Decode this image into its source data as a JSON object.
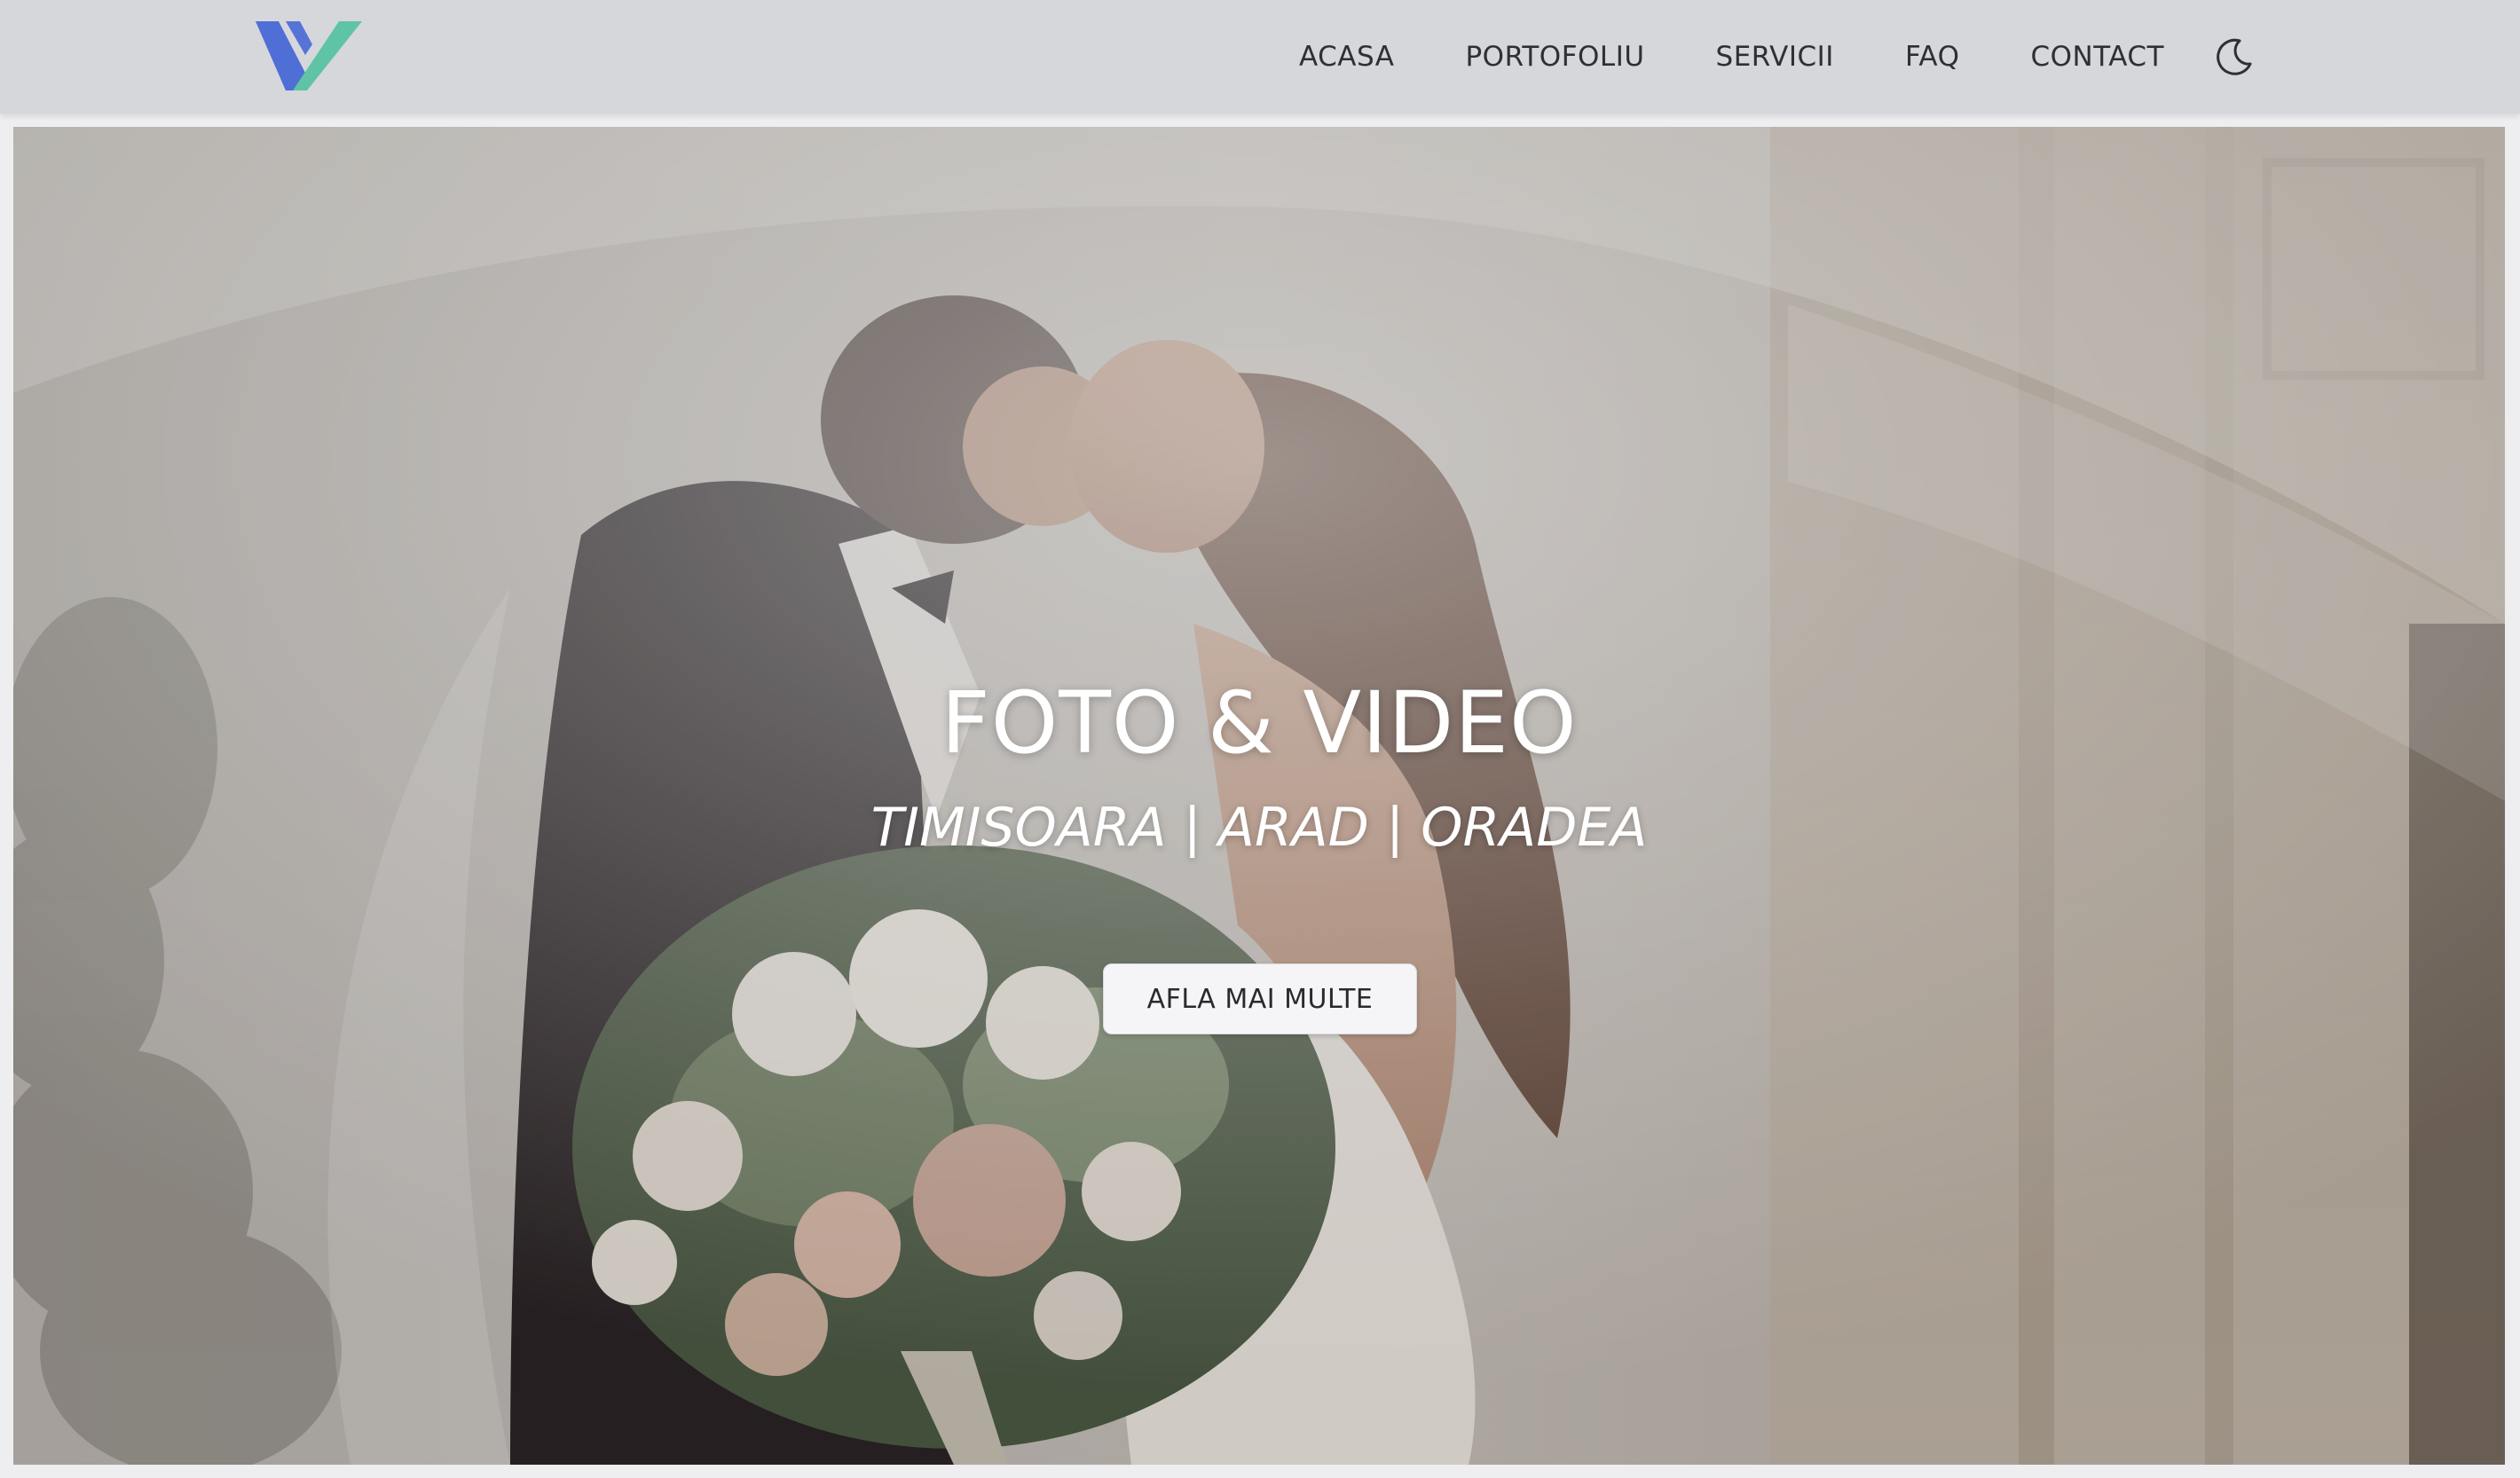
{
  "header": {
    "logo_icon": "v-logo-icon",
    "nav": [
      {
        "label": "ACASA"
      },
      {
        "label": "PORTOFOLIU"
      },
      {
        "label": "SERVICII"
      },
      {
        "label": "FAQ"
      },
      {
        "label": "CONTACT"
      }
    ],
    "theme_toggle_icon": "moon-icon"
  },
  "hero": {
    "title": "FOTO & VIDEO",
    "subtitle": "TIMISOARA | ARAD | ORADEA",
    "button_label": "AFLA MAI MULTE",
    "image_icon": "wedding-couple-photo"
  },
  "colors": {
    "navbar_bg": "#d6d7da",
    "page_bg": "#eeeef0",
    "logo_blue": "#4f6fd6",
    "logo_teal": "#5fc3a6",
    "nav_text": "#2f3034",
    "hero_text": "#ffffff",
    "button_bg": "#f5f5f7"
  }
}
